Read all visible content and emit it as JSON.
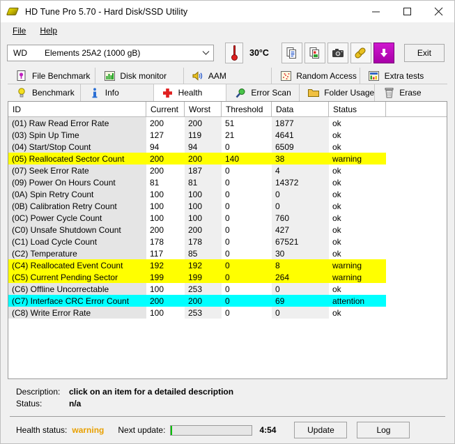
{
  "window": {
    "title": "HD Tune Pro 5.70 - Hard Disk/SSD Utility",
    "icon": "hard-disk-icon",
    "minimize": "—",
    "maximize": "□",
    "close": "✕"
  },
  "menu": [
    {
      "label": "File"
    },
    {
      "label": "Help"
    }
  ],
  "toolbar": {
    "drive_vendor": "WD",
    "drive_model": "Elements 25A2 (1000 gB)",
    "dropdown_arrow": "⌄",
    "temperature": "30°C",
    "thermometer_icon": "thermometer-icon",
    "buttons": [
      {
        "name": "copy-text-icon"
      },
      {
        "name": "copy-image-icon"
      },
      {
        "name": "screenshot-camera-icon"
      },
      {
        "name": "network-share-icon"
      },
      {
        "name": "download-arrow-icon"
      }
    ],
    "exit_label": "Exit"
  },
  "tabs": {
    "row1": [
      {
        "label": "File Benchmark",
        "icon": "file-benchmark-icon",
        "active": false
      },
      {
        "label": "Disk monitor",
        "icon": "disk-monitor-icon",
        "active": false
      },
      {
        "label": "AAM",
        "icon": "speaker-icon",
        "active": false
      },
      {
        "label": "Random Access",
        "icon": "random-access-icon",
        "active": false
      },
      {
        "label": "Extra tests",
        "icon": "extra-tests-icon",
        "active": false
      }
    ],
    "row2": [
      {
        "label": "Benchmark",
        "icon": "lightbulb-icon",
        "active": false
      },
      {
        "label": "Info",
        "icon": "info-icon",
        "active": false
      },
      {
        "label": "Health",
        "icon": "red-cross-icon",
        "active": true
      },
      {
        "label": "Error Scan",
        "icon": "magnifier-icon",
        "active": false
      },
      {
        "label": "Folder Usage",
        "icon": "folder-icon",
        "active": false
      },
      {
        "label": "Erase",
        "icon": "trash-icon",
        "active": false
      }
    ]
  },
  "table": {
    "columns": [
      "ID",
      "Current",
      "Worst",
      "Threshold",
      "Data",
      "Status"
    ],
    "rows": [
      {
        "id": "(01) Raw Read Error Rate",
        "current": "200",
        "worst": "200",
        "threshold": "51",
        "data": "1877",
        "status": "ok",
        "highlight": "none"
      },
      {
        "id": "(03) Spin Up Time",
        "current": "127",
        "worst": "119",
        "threshold": "21",
        "data": "4641",
        "status": "ok",
        "highlight": "none"
      },
      {
        "id": "(04) Start/Stop Count",
        "current": "94",
        "worst": "94",
        "threshold": "0",
        "data": "6509",
        "status": "ok",
        "highlight": "none"
      },
      {
        "id": "(05) Reallocated Sector Count",
        "current": "200",
        "worst": "200",
        "threshold": "140",
        "data": "38",
        "status": "warning",
        "highlight": "warn"
      },
      {
        "id": "(07) Seek Error Rate",
        "current": "200",
        "worst": "187",
        "threshold": "0",
        "data": "4",
        "status": "ok",
        "highlight": "none"
      },
      {
        "id": "(09) Power On Hours Count",
        "current": "81",
        "worst": "81",
        "threshold": "0",
        "data": "14372",
        "status": "ok",
        "highlight": "none"
      },
      {
        "id": "(0A) Spin Retry Count",
        "current": "100",
        "worst": "100",
        "threshold": "0",
        "data": "0",
        "status": "ok",
        "highlight": "none"
      },
      {
        "id": "(0B) Calibration Retry Count",
        "current": "100",
        "worst": "100",
        "threshold": "0",
        "data": "0",
        "status": "ok",
        "highlight": "none"
      },
      {
        "id": "(0C) Power Cycle Count",
        "current": "100",
        "worst": "100",
        "threshold": "0",
        "data": "760",
        "status": "ok",
        "highlight": "none"
      },
      {
        "id": "(C0) Unsafe Shutdown Count",
        "current": "200",
        "worst": "200",
        "threshold": "0",
        "data": "427",
        "status": "ok",
        "highlight": "none"
      },
      {
        "id": "(C1) Load Cycle Count",
        "current": "178",
        "worst": "178",
        "threshold": "0",
        "data": "67521",
        "status": "ok",
        "highlight": "none"
      },
      {
        "id": "(C2) Temperature",
        "current": "117",
        "worst": "85",
        "threshold": "0",
        "data": "30",
        "status": "ok",
        "highlight": "none"
      },
      {
        "id": "(C4) Reallocated Event Count",
        "current": "192",
        "worst": "192",
        "threshold": "0",
        "data": "8",
        "status": "warning",
        "highlight": "warn"
      },
      {
        "id": "(C5) Current Pending Sector",
        "current": "199",
        "worst": "199",
        "threshold": "0",
        "data": "264",
        "status": "warning",
        "highlight": "warn"
      },
      {
        "id": "(C6) Offline Uncorrectable",
        "current": "100",
        "worst": "253",
        "threshold": "0",
        "data": "0",
        "status": "ok",
        "highlight": "none"
      },
      {
        "id": "(C7) Interface CRC Error Count",
        "current": "200",
        "worst": "200",
        "threshold": "0",
        "data": "69",
        "status": "attention",
        "highlight": "attn"
      },
      {
        "id": "(C8) Write Error Rate",
        "current": "100",
        "worst": "253",
        "threshold": "0",
        "data": "0",
        "status": "ok",
        "highlight": "none"
      }
    ]
  },
  "details": {
    "description_label": "Description:",
    "description_value": "click on an item for a detailed description",
    "status_label": "Status:",
    "status_value": "n/a"
  },
  "statusbar": {
    "health_label": "Health status:",
    "health_value": "warning",
    "next_update_label": "Next update:",
    "progress_percent": 2,
    "time_remaining": "4:54",
    "update_label": "Update",
    "log_label": "Log"
  },
  "colors": {
    "warning_row": "#ffff00",
    "attention_row": "#00ffff",
    "health_warning_text": "#e8a000",
    "progress_fill": "#00c000",
    "window_bg": "#f0f0f0"
  }
}
